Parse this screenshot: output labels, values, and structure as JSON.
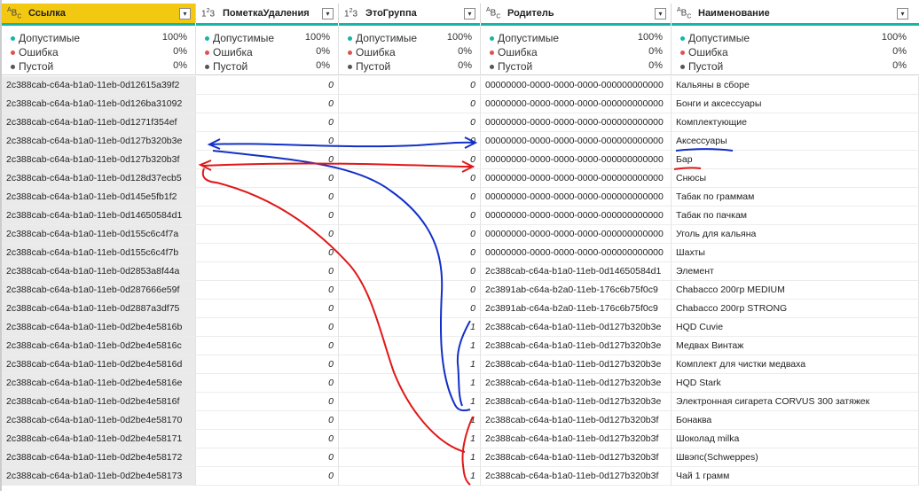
{
  "columns": [
    {
      "type": "A B C",
      "title": "Ссылка",
      "selected": true
    },
    {
      "type": "1 2 3",
      "title": "ПометкаУдаления",
      "selected": false
    },
    {
      "type": "1 2 3",
      "title": "ЭтоГруппа",
      "selected": false
    },
    {
      "type": "A B C",
      "title": "Родитель",
      "selected": false
    },
    {
      "type": "A B C",
      "title": "Наименование",
      "selected": false
    }
  ],
  "quality_labels": {
    "valid": "Допустимые",
    "error": "Ошибка",
    "empty": "Пустой"
  },
  "quality_values": {
    "valid": "100%",
    "error": "0%",
    "empty": "0%"
  },
  "colors": {
    "valid": "#16b5a5",
    "error": "#e05252",
    "empty": "#555555",
    "header_selected": "#f2c811",
    "annotation_blue": "#1230c8",
    "annotation_red": "#e01818"
  },
  "rows": [
    [
      "2c388cab-c64a-b1a0-11eb-0d12615a39f2",
      "0",
      "0",
      "00000000-0000-0000-0000-000000000000",
      "Кальяны в сборе"
    ],
    [
      "2c388cab-c64a-b1a0-11eb-0d126ba31092",
      "0",
      "0",
      "00000000-0000-0000-0000-000000000000",
      "Бонги и аксессуары"
    ],
    [
      "2c388cab-c64a-b1a0-11eb-0d1271f354ef",
      "0",
      "0",
      "00000000-0000-0000-0000-000000000000",
      "Комплектующие"
    ],
    [
      "2c388cab-c64a-b1a0-11eb-0d127b320b3e",
      "0",
      "0",
      "00000000-0000-0000-0000-000000000000",
      "Аксессуары"
    ],
    [
      "2c388cab-c64a-b1a0-11eb-0d127b320b3f",
      "0",
      "0",
      "00000000-0000-0000-0000-000000000000",
      "Бар"
    ],
    [
      "2c388cab-c64a-b1a0-11eb-0d128d37ecb5",
      "0",
      "0",
      "00000000-0000-0000-0000-000000000000",
      "Снюсы"
    ],
    [
      "2c388cab-c64a-b1a0-11eb-0d145e5fb1f2",
      "0",
      "0",
      "00000000-0000-0000-0000-000000000000",
      "Табак по граммам"
    ],
    [
      "2c388cab-c64a-b1a0-11eb-0d14650584d1",
      "0",
      "0",
      "00000000-0000-0000-0000-000000000000",
      "Табак по пачкам"
    ],
    [
      "2c388cab-c64a-b1a0-11eb-0d155c6c4f7a",
      "0",
      "0",
      "00000000-0000-0000-0000-000000000000",
      "Уголь для кальяна"
    ],
    [
      "2c388cab-c64a-b1a0-11eb-0d155c6c4f7b",
      "0",
      "0",
      "00000000-0000-0000-0000-000000000000",
      "Шахты"
    ],
    [
      "2c388cab-c64a-b1a0-11eb-0d2853a8f44a",
      "0",
      "0",
      "2c388cab-c64a-b1a0-11eb-0d14650584d1",
      "Элемент"
    ],
    [
      "2c388cab-c64a-b1a0-11eb-0d287666e59f",
      "0",
      "0",
      "2c3891ab-c64a-b2a0-11eb-176c6b75f0c9",
      "Chabacco 200гр MEDIUM"
    ],
    [
      "2c388cab-c64a-b1a0-11eb-0d2887a3df75",
      "0",
      "0",
      "2c3891ab-c64a-b2a0-11eb-176c6b75f0c9",
      "Chabacco 200гр STRONG"
    ],
    [
      "2c388cab-c64a-b1a0-11eb-0d2be4e5816b",
      "0",
      "1",
      "2c388cab-c64a-b1a0-11eb-0d127b320b3e",
      "HQD Cuvie"
    ],
    [
      "2c388cab-c64a-b1a0-11eb-0d2be4e5816c",
      "0",
      "1",
      "2c388cab-c64a-b1a0-11eb-0d127b320b3e",
      "Медвах Винтаж"
    ],
    [
      "2c388cab-c64a-b1a0-11eb-0d2be4e5816d",
      "0",
      "1",
      "2c388cab-c64a-b1a0-11eb-0d127b320b3e",
      "Комплект для чистки медваха"
    ],
    [
      "2c388cab-c64a-b1a0-11eb-0d2be4e5816e",
      "0",
      "1",
      "2c388cab-c64a-b1a0-11eb-0d127b320b3e",
      "HQD Stark"
    ],
    [
      "2c388cab-c64a-b1a0-11eb-0d2be4e5816f",
      "0",
      "1",
      "2c388cab-c64a-b1a0-11eb-0d127b320b3e",
      "Электронная сигарета CORVUS 300 затяжек"
    ],
    [
      "2c388cab-c64a-b1a0-11eb-0d2be4e58170",
      "0",
      "1",
      "2c388cab-c64a-b1a0-11eb-0d127b320b3f",
      "Бонаква"
    ],
    [
      "2c388cab-c64a-b1a0-11eb-0d2be4e58171",
      "0",
      "1",
      "2c388cab-c64a-b1a0-11eb-0d127b320b3f",
      "Шоколад milka"
    ],
    [
      "2c388cab-c64a-b1a0-11eb-0d2be4e58172",
      "0",
      "1",
      "2c388cab-c64a-b1a0-11eb-0d127b320b3f",
      "Швэпс(Schweppes)"
    ],
    [
      "2c388cab-c64a-b1a0-11eb-0d2be4e58173",
      "0",
      "1",
      "2c388cab-c64a-b1a0-11eb-0d127b320b3f",
      "Чай 1 грамм"
    ]
  ]
}
